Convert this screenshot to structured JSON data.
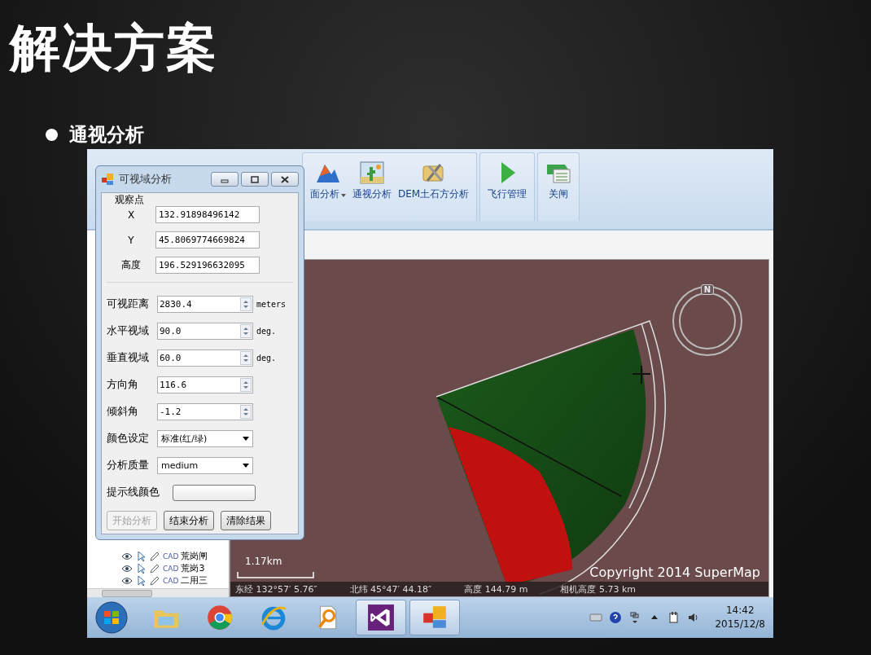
{
  "title": "解决方案",
  "bullets": [
    "通视分析"
  ],
  "ribbon": {
    "groups": [
      {
        "items": [
          {
            "label": "面分析",
            "dropdown": true
          },
          {
            "label": "通视分析",
            "dropdown": false
          },
          {
            "label": "DEM土石方分析",
            "dropdown": false
          }
        ]
      },
      {
        "items": [
          {
            "label": "飞行管理",
            "dropdown": false
          }
        ]
      },
      {
        "items": [
          {
            "label": "关闸",
            "dropdown": false
          }
        ]
      }
    ]
  },
  "layer_tree": {
    "items": [
      {
        "type": "CAD",
        "name": "荒岗闸"
      },
      {
        "type": "CAD",
        "name": "荒岗3"
      },
      {
        "type": "CAD",
        "name": "二用三"
      }
    ]
  },
  "map": {
    "compass": "N",
    "scale": "1.17km",
    "copyright": "Copyright 2014 SuperMap",
    "status": [
      "东经 132°57′ 5.76″",
      "北纬 45°47′ 44.18″",
      "高度 144.79 m",
      "相机高度 5.73 km"
    ]
  },
  "dialog": {
    "title": "可视域分析",
    "group": "观察点",
    "points": [
      {
        "label": "X",
        "value": "132.91898496142"
      },
      {
        "label": "Y",
        "value": "45.8069774669824"
      },
      {
        "label": "高度",
        "value": "196.529196632095"
      }
    ],
    "rows": [
      {
        "kind": "spin",
        "label": "可视距离",
        "value": "2830.4",
        "unit": "meters"
      },
      {
        "kind": "spin",
        "label": "水平视域",
        "value": "90.0",
        "unit": "deg."
      },
      {
        "kind": "spin",
        "label": "垂直视域",
        "value": "60.0",
        "unit": "deg."
      },
      {
        "kind": "spin",
        "label": "方向角",
        "value": "116.6"
      },
      {
        "kind": "spin",
        "label": "倾斜角",
        "value": "-1.2"
      },
      {
        "kind": "combo",
        "label": "颜色设定",
        "value": "标准(红/绿)"
      },
      {
        "kind": "combo",
        "label": "分析质量",
        "value": "medium"
      },
      {
        "kind": "color",
        "label": "提示线颜色"
      }
    ],
    "buttons": [
      {
        "label": "开始分析",
        "disabled": true
      },
      {
        "label": "结束分析",
        "disabled": false
      },
      {
        "label": "清除结果",
        "disabled": false
      }
    ]
  },
  "taskbar": {
    "apps": [
      {
        "selected": false
      },
      {
        "selected": false
      },
      {
        "selected": false
      },
      {
        "selected": false
      },
      {
        "selected": true
      },
      {
        "selected": true
      }
    ],
    "time": "14:42",
    "date": "2015/12/8"
  }
}
